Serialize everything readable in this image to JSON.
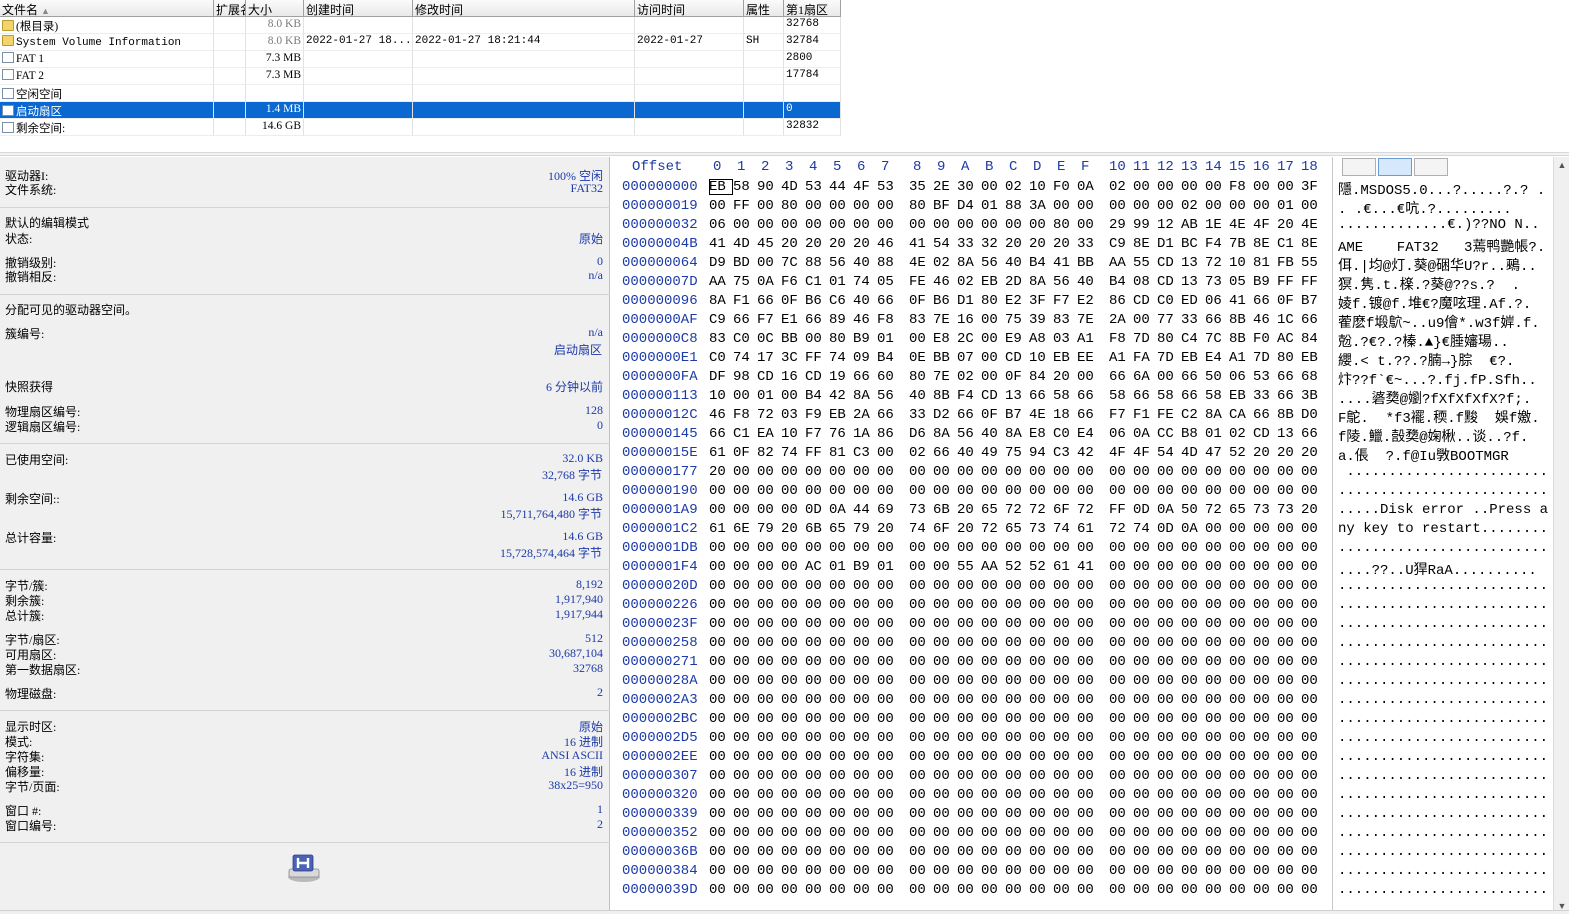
{
  "file_table": {
    "columns": [
      "文件名",
      "扩展名",
      "大小",
      "创建时间",
      "修改时间",
      "访问时间",
      "属性",
      "第1扇区"
    ],
    "sort_indicator": "▲",
    "rows": [
      {
        "icon": "folder-icon",
        "name": "(根目录)",
        "ext": "",
        "size": "8.0 KB",
        "size_grey": true,
        "created": "",
        "modified": "",
        "accessed": "",
        "attr": "",
        "sector": "32768",
        "selected": false
      },
      {
        "icon": "folder-icon",
        "name": "System Volume Information",
        "ext": "",
        "size": "8.0 KB",
        "size_grey": true,
        "created": "2022-01-27  18...",
        "modified": "2022-01-27  18:21:44",
        "accessed": "2022-01-27",
        "attr": "SH",
        "sector": "32784",
        "selected": false
      },
      {
        "icon": "doc-icon",
        "name": "FAT 1",
        "ext": "",
        "size": "7.3 MB",
        "size_grey": false,
        "created": "",
        "modified": "",
        "accessed": "",
        "attr": "",
        "sector": "2800",
        "selected": false
      },
      {
        "icon": "doc-icon",
        "name": "FAT 2",
        "ext": "",
        "size": "7.3 MB",
        "size_grey": false,
        "created": "",
        "modified": "",
        "accessed": "",
        "attr": "",
        "sector": "17784",
        "selected": false
      },
      {
        "icon": "doc-icon",
        "name": "空闲空间",
        "ext": "",
        "size": "",
        "size_grey": false,
        "created": "",
        "modified": "",
        "accessed": "",
        "attr": "",
        "sector": "",
        "selected": false
      },
      {
        "icon": "doc-icon",
        "name": "启动扇区",
        "ext": "",
        "size": "1.4 MB",
        "size_grey": false,
        "created": "",
        "modified": "",
        "accessed": "",
        "attr": "",
        "sector": "0",
        "selected": true
      },
      {
        "icon": "doc-icon",
        "name": "剩余空间:",
        "ext": "",
        "size": "14.6 GB",
        "size_grey": false,
        "created": "",
        "modified": "",
        "accessed": "",
        "attr": "",
        "sector": "32832",
        "selected": false
      }
    ]
  },
  "info_panel": {
    "drive_label": "驱动器I:",
    "drive_value": "100% 空闲",
    "fs_label": "文件系统:",
    "fs_value": "FAT32",
    "edit_mode_label": "默认的编辑模式",
    "state_label": "状态:",
    "state_value": "原始",
    "undo_level_label": "撤销级别:",
    "undo_level_value": "0",
    "undo_reverse_label": "撤销相反:",
    "undo_reverse_value": "n/a",
    "alloc_label": "分配可见的驱动器空间。",
    "cluster_no_label": "簇编号:",
    "cluster_no_value": "n/a",
    "cluster_no_value2": "启动扇区",
    "snapshot_label": "快照获得",
    "snapshot_value": "6 分钟以前",
    "phys_sector_label": "物理扇区编号:",
    "phys_sector_value": "128",
    "log_sector_label": "逻辑扇区编号:",
    "log_sector_value": "0",
    "used_label": "已使用空间:",
    "used_value1": "32.0 KB",
    "used_value2": "32,768 字节",
    "free_label": "剩余空间::",
    "free_value1": "14.6 GB",
    "free_value2": "15,711,764,480 字节",
    "total_label": "总计容量:",
    "total_value1": "14.6 GB",
    "total_value2": "15,728,574,464 字节",
    "bpc_label": "字节/簇:",
    "bpc_value": "8,192",
    "free_clusters_label": "剩余簇:",
    "free_clusters_value": "1,917,940",
    "total_clusters_label": "总计簇:",
    "total_clusters_value": "1,917,944",
    "bps_label": "字节/扇区:",
    "bps_value": "512",
    "avail_sectors_label": "可用扇区:",
    "avail_sectors_value": "30,687,104",
    "first_data_label": "第一数据扇区:",
    "first_data_value": "32768",
    "phys_disk_label": "物理磁盘:",
    "phys_disk_value": "2",
    "display_tz_label": "显示时区:",
    "display_tz_value": "原始",
    "mode_label": "模式:",
    "mode_value": "16 进制",
    "charset_label": "字符集:",
    "charset_value": "ANSI ASCII",
    "offset_label": "偏移量:",
    "offset_value": "16 进制",
    "bpp_label": "字节/页面:",
    "bpp_value": "38x25=950",
    "window_no_label": "窗口 #:",
    "window_no_value": "1",
    "window_num_label": "窗口编号:",
    "window_num_value": "2"
  },
  "hex": {
    "offset_label": "Offset",
    "columns": [
      "0",
      "1",
      "2",
      "3",
      "4",
      "5",
      "6",
      "7",
      "8",
      "9",
      "A",
      "B",
      "C",
      "D",
      "E",
      "F",
      "10",
      "11",
      "12",
      "13",
      "14",
      "15",
      "16",
      "17",
      "18"
    ],
    "rows": [
      {
        "off": "000000000",
        "bytes": "EB 58 90 4D 53 44 4F 53 35 2E 30 00 02 10 F0 0A 02 00 00 00 00 F8 00 00 3F",
        "ascii": "隱.MSDOS5.0...?.....?.? ."
      },
      {
        "off": "000000019",
        "bytes": "00 FF 00 80 00 00 00 00 80 BF D4 01 88 3A 00 00 00 00 00 02 00 00 00 01 00",
        "ascii": ". .€...€吭.?........."
      },
      {
        "off": "000000032",
        "bytes": "06 00 00 00 00 00 00 00 00 00 00 00 00 00 80 00 29 99 12 AB 1E 4E 4F 20 4E",
        "ascii": ".............€.)??NO N.."
      },
      {
        "off": "00000004B",
        "bytes": "41 4D 45 20 20 20 20 46 41 54 33 32 20 20 20 33 C9 8E D1 BC F4 7B 8E C1 8E",
        "ascii": "AME    FAT32   3蔫鸭艷帳?."
      },
      {
        "off": "000000064",
        "bytes": "D9 BD 00 7C 88 56 40 88 4E 02 8A 56 40 B4 41 BB AA 55 CD 13 72 10 81 FB 55",
        "ascii": "佴.|均@灯.葵@硱华U?r..鵐.."
      },
      {
        "off": "00000007D",
        "bytes": "AA 75 0A F6 C1 01 74 05 FE 46 02 EB 2D 8A 56 40 B4 08 CD 13 73 05 B9 FF FF",
        "ascii": "猽.隽.t.檪.?葵@??s.?  ."
      },
      {
        "off": "000000096",
        "bytes": "8A F1 66 0F B6 C6 40 66 0F B6 D1 80 E2 3F F7 E2 86 CD C0 ED 06 41 66 0F B7",
        "ascii": "婈f.镀@f.堆€?魔呟理.Af.?."
      },
      {
        "off": "0000000AF",
        "bytes": "C9 66 F7 E1 66 89 46 F8 83 7E 16 00 75 39 83 7E 2A 00 77 33 66 8B 46 1C 66",
        "ascii": "蒮麽f塅鴥~..u9儈*.w3f婩.f."
      },
      {
        "off": "0000000C8",
        "bytes": "83 C0 0C BB 00 80 B9 01 00 E8 2C 00 E9 A8 03 A1 F8 7D 80 C4 7C 8B F0 AC 84",
        "ascii": "兝.?€?.?榛.▲}€腄嬸瑒.."
      },
      {
        "off": "0000000E1",
        "bytes": "C0 74 17 3C FF 74 09 B4 0E BB 07 00 CD 10 EB EE A1 FA 7D EB E4 A1 7D 80 EB",
        "ascii": "纓.< t.??.?腩→}腙  €?."
      },
      {
        "off": "0000000FA",
        "bytes": "DF 98 CD 16 CD 19 66 60 80 7E 02 00 0F 84 20 00 66 6A 00 66 50 06 53 66 68",
        "ascii": "炞??f`€~...?.fj.fP.Sfh.."
      },
      {
        "off": "000000113",
        "bytes": "10 00 01 00 B4 42 8A 56 40 8B F4 CD 13 66 58 66 58 66 58 66 58 EB 33 66 3B",
        "ascii": "....碆奦@嬼?fXfXfXfX?f;."
      },
      {
        "off": "00000012C",
        "bytes": "46 F8 72 03 F9 EB 2A 66 33 D2 66 0F B7 4E 18 66 F7 F1 FE C2 8A CA 66 8B D0",
        "ascii": "F鴕.  *f3襬.稬.f黢  娛f嬓."
      },
      {
        "off": "000000145",
        "bytes": "66 C1 EA 10 F7 76 1A 86 D6 8A 56 40 8A E8 C0 E4 06 0A CC B8 01 02 CD 13 66",
        "ascii": "f陵.鱲.嗀奦@婅楸..谈..?f."
      },
      {
        "off": "00000015E",
        "bytes": "61 0F 82 74 FF 81 C3 00 02 66 40 49 75 94 C3 42 4F 4F 54 4D 47 52 20 20 20",
        "ascii": "a.倀  ?.f@Iu斆BOOTMGR   "
      },
      {
        "off": "000000177",
        "bytes": "20 00 00 00 00 00 00 00 00 00 00 00 00 00 00 00 00 00 00 00 00 00 00 00 00",
        "ascii": " ........................"
      },
      {
        "off": "000000190",
        "bytes": "00 00 00 00 00 00 00 00 00 00 00 00 00 00 00 00 00 00 00 00 00 00 00 00 00",
        "ascii": "........................."
      },
      {
        "off": "0000001A9",
        "bytes": "00 00 00 00 0D 0A 44 69 73 6B 20 65 72 72 6F 72 FF 0D 0A 50 72 65 73 73 20",
        "ascii": ".....Disk error ..Press a"
      },
      {
        "off": "0000001C2",
        "bytes": "61 6E 79 20 6B 65 79 20 74 6F 20 72 65 73 74 61 72 74 0D 0A 00 00 00 00 00",
        "ascii": "ny key to restart........"
      },
      {
        "off": "0000001DB",
        "bytes": "00 00 00 00 00 00 00 00 00 00 00 00 00 00 00 00 00 00 00 00 00 00 00 00 00",
        "ascii": "........................."
      },
      {
        "off": "0000001F4",
        "bytes": "00 00 00 00 AC 01 B9 01 00 00 55 AA 52 52 61 41 00 00 00 00 00 00 00 00 00",
        "ascii": "....??..U猂RaA.........."
      },
      {
        "off": "00000020D",
        "bytes": "00 00 00 00 00 00 00 00 00 00 00 00 00 00 00 00 00 00 00 00 00 00 00 00 00",
        "ascii": "........................."
      },
      {
        "off": "000000226",
        "bytes": "00 00 00 00 00 00 00 00 00 00 00 00 00 00 00 00 00 00 00 00 00 00 00 00 00",
        "ascii": "........................."
      },
      {
        "off": "00000023F",
        "bytes": "00 00 00 00 00 00 00 00 00 00 00 00 00 00 00 00 00 00 00 00 00 00 00 00 00",
        "ascii": "........................."
      },
      {
        "off": "000000258",
        "bytes": "00 00 00 00 00 00 00 00 00 00 00 00 00 00 00 00 00 00 00 00 00 00 00 00 00",
        "ascii": "........................."
      },
      {
        "off": "000000271",
        "bytes": "00 00 00 00 00 00 00 00 00 00 00 00 00 00 00 00 00 00 00 00 00 00 00 00 00",
        "ascii": "........................."
      },
      {
        "off": "00000028A",
        "bytes": "00 00 00 00 00 00 00 00 00 00 00 00 00 00 00 00 00 00 00 00 00 00 00 00 00",
        "ascii": "........................."
      },
      {
        "off": "0000002A3",
        "bytes": "00 00 00 00 00 00 00 00 00 00 00 00 00 00 00 00 00 00 00 00 00 00 00 00 00",
        "ascii": "........................."
      },
      {
        "off": "0000002BC",
        "bytes": "00 00 00 00 00 00 00 00 00 00 00 00 00 00 00 00 00 00 00 00 00 00 00 00 00",
        "ascii": "........................."
      },
      {
        "off": "0000002D5",
        "bytes": "00 00 00 00 00 00 00 00 00 00 00 00 00 00 00 00 00 00 00 00 00 00 00 00 00",
        "ascii": "........................."
      },
      {
        "off": "0000002EE",
        "bytes": "00 00 00 00 00 00 00 00 00 00 00 00 00 00 00 00 00 00 00 00 00 00 00 00 00",
        "ascii": "........................."
      },
      {
        "off": "000000307",
        "bytes": "00 00 00 00 00 00 00 00 00 00 00 00 00 00 00 00 00 00 00 00 00 00 00 00 00",
        "ascii": "........................."
      },
      {
        "off": "000000320",
        "bytes": "00 00 00 00 00 00 00 00 00 00 00 00 00 00 00 00 00 00 00 00 00 00 00 00 00",
        "ascii": "........................."
      },
      {
        "off": "000000339",
        "bytes": "00 00 00 00 00 00 00 00 00 00 00 00 00 00 00 00 00 00 00 00 00 00 00 00 00",
        "ascii": "........................."
      },
      {
        "off": "000000352",
        "bytes": "00 00 00 00 00 00 00 00 00 00 00 00 00 00 00 00 00 00 00 00 00 00 00 00 00",
        "ascii": "........................."
      },
      {
        "off": "00000036B",
        "bytes": "00 00 00 00 00 00 00 00 00 00 00 00 00 00 00 00 00 00 00 00 00 00 00 00 00",
        "ascii": "........................."
      },
      {
        "off": "000000384",
        "bytes": "00 00 00 00 00 00 00 00 00 00 00 00 00 00 00 00 00 00 00 00 00 00 00 00 00",
        "ascii": "........................."
      },
      {
        "off": "00000039D",
        "bytes": "00 00 00 00 00 00 00 00 00 00 00 00 00 00 00 00 00 00 00 00 00 00 00 00 00",
        "ascii": "........................."
      }
    ]
  },
  "colors": {
    "accent": "#0a68d0",
    "value_text": "#1c3aa8",
    "offset_text": "#1c3aa8"
  }
}
